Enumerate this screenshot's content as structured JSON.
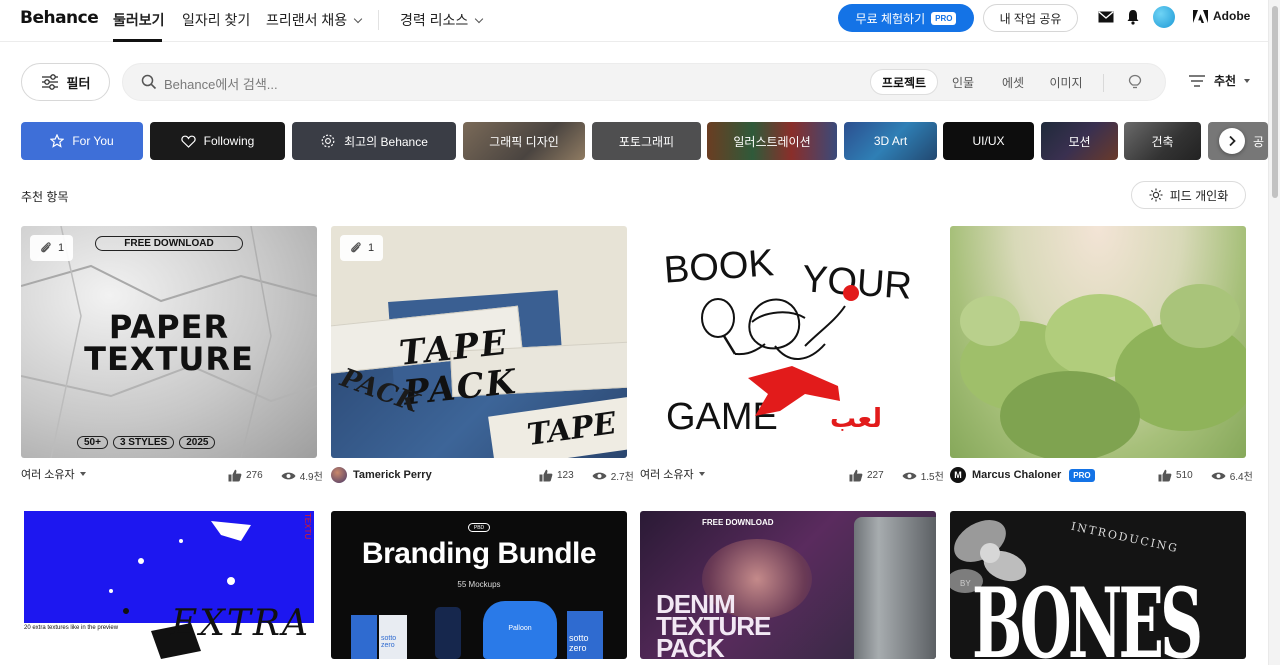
{
  "brand": "Behance",
  "nav": {
    "links": [
      "둘러보기",
      "일자리 찾기",
      "프리랜서 채용",
      "경력 리소스"
    ],
    "trial_label": "무료 체험하기",
    "pro_label": "PRO",
    "share_label": "내 작업 공유",
    "adobe_label": "Adobe"
  },
  "filter_label": "필터",
  "search": {
    "placeholder": "Behance에서 검색...",
    "segments": [
      "프로젝트",
      "인물",
      "에셋",
      "이미지"
    ],
    "active_segment": "프로젝트"
  },
  "sort_label": "추천",
  "categories": [
    "For You",
    "Following",
    "최고의 Behance",
    "그래픽 디자인",
    "포토그래피",
    "일러스트레이션",
    "3D Art",
    "UI/UX",
    "모션",
    "건축",
    "공"
  ],
  "section_title": "추천 항목",
  "personalize_label": "피드 개인화",
  "cards": [
    {
      "owner": "여러 소유자",
      "likes": "276",
      "views": "4.9천",
      "attachments": "1",
      "art": {
        "badge": "FREE DOWNLOAD",
        "line1": "PAPER",
        "line2": "TEXTURE",
        "tags": [
          "50+",
          "3 STYLES",
          "2025"
        ]
      }
    },
    {
      "owner": "Tamerick Perry",
      "likes": "123",
      "views": "2.7천",
      "attachments": "1",
      "art": {
        "line1": "TAPE PACK",
        "line2": "PACK",
        "line3": "TAPE"
      }
    },
    {
      "owner": "여러 소유자",
      "likes": "227",
      "views": "1.5천",
      "art": {
        "line1": "BOOK",
        "line2": "YOUR",
        "line3": "GAME",
        "arabic": "لعب"
      }
    },
    {
      "owner": "Marcus Chaloner",
      "pro": "PRO",
      "likes": "510",
      "views": "6.4천"
    }
  ],
  "row2": {
    "c1": {
      "word": "EXTRA",
      "caption": "20 extra textures like in the preview",
      "side": "TEXTU"
    },
    "c2": {
      "title": "Branding Bundle",
      "subtitle": "55 Mockups",
      "logo": "PBD",
      "brand1": "sotto zero",
      "brand2": "Palloon"
    },
    "c3": {
      "badge": "FREE DOWNLOAD",
      "line1": "DENIM",
      "line2": "TEXTURE",
      "line3": "PACK"
    },
    "c4": {
      "arc": "INTRODUCING",
      "word": "BONES",
      "pre": "BY"
    }
  },
  "colors": {
    "accent": "#1473e6",
    "for_you": "#3e6fd8"
  }
}
